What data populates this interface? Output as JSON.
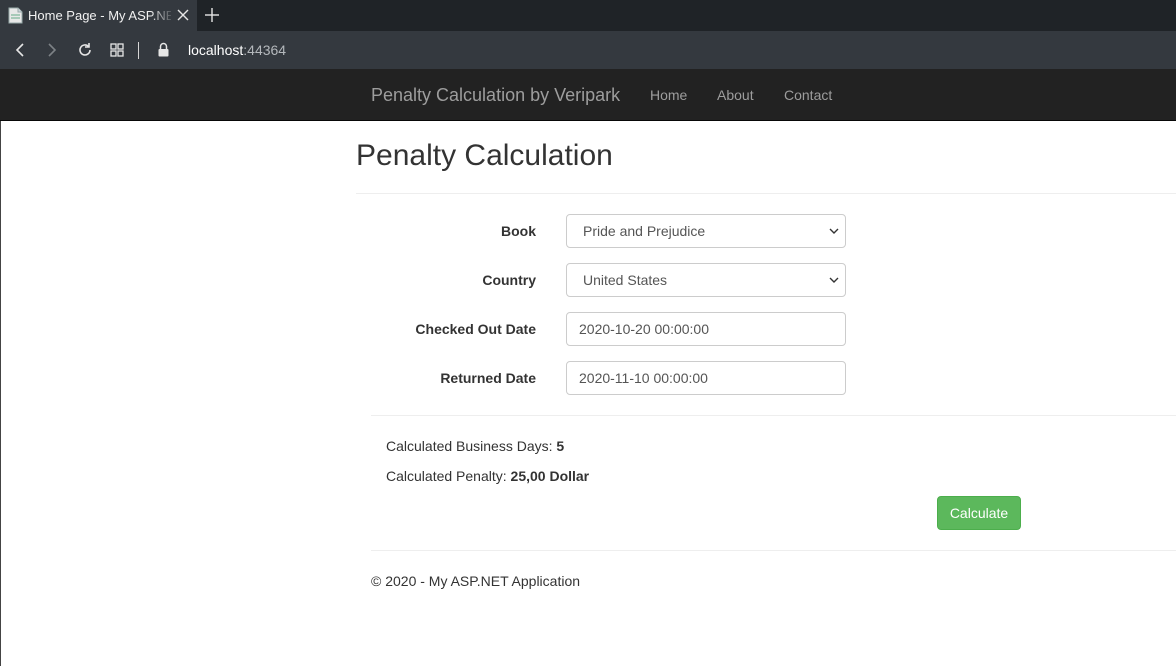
{
  "browser": {
    "tab_title": "Home Page - My ASP.NET Application",
    "url_host": "localhost",
    "url_port": ":44364"
  },
  "navbar": {
    "brand": "Penalty Calculation by Veripark",
    "links": [
      "Home",
      "About",
      "Contact"
    ]
  },
  "page": {
    "title": "Penalty Calculation"
  },
  "form": {
    "book_label": "Book",
    "book_value": "Pride and Prejudice",
    "country_label": "Country",
    "country_value": "United States",
    "checkout_label": "Checked Out Date",
    "checkout_value": "2020-10-20 00:00:00",
    "returned_label": "Returned Date",
    "returned_value": "2020-11-10 00:00:00"
  },
  "results": {
    "business_days_label": "Calculated Business Days:",
    "business_days_value": "5",
    "penalty_label": "Calculated Penalty:",
    "penalty_value": "25,00 Dollar"
  },
  "actions": {
    "calculate_label": "Calculate"
  },
  "footer": {
    "text": "© 2020 - My ASP.NET Application"
  },
  "colors": {
    "navbar_bg": "#222222",
    "button_success": "#5cb85c"
  }
}
